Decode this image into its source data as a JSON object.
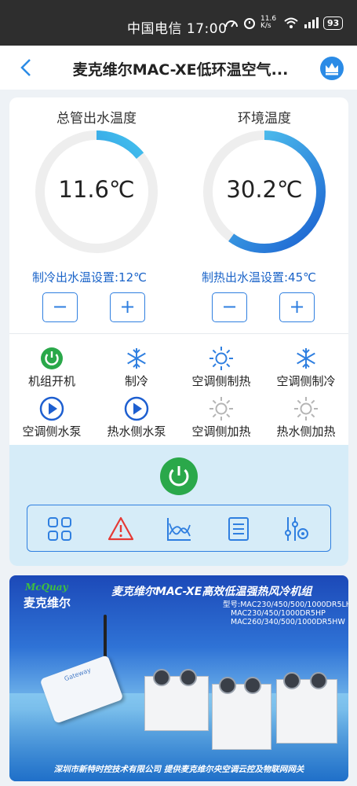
{
  "status_bar": {
    "text": "中国电信 17:00",
    "net_speed": "11.6 K/s",
    "battery": "93"
  },
  "nav": {
    "title": "麦克维尔MAC-XE低环温空气..."
  },
  "gauges": [
    {
      "title": "总管出水温度",
      "value": "11.6℃",
      "level": 0.14,
      "setpoint_label": "制冷出水温设置:12℃"
    },
    {
      "title": "环境温度",
      "value": "30.2℃",
      "level": 0.6,
      "setpoint_label": "制热出水温设置:45℃"
    }
  ],
  "buttons": {
    "minus": "−",
    "plus": "+"
  },
  "status_items": [
    {
      "label": "机组开机",
      "icon": "power-icon",
      "active": true
    },
    {
      "label": "制冷",
      "icon": "snowflake-icon",
      "active": true
    },
    {
      "label": "空调侧制热",
      "icon": "sun-icon",
      "active": true
    },
    {
      "label": "空调侧制冷",
      "icon": "snowflake-icon",
      "active": true
    },
    {
      "label": "空调侧水泵",
      "icon": "play-icon",
      "active": true
    },
    {
      "label": "热水侧水泵",
      "icon": "play-icon",
      "active": true
    },
    {
      "label": "空调侧加热",
      "icon": "sun-icon",
      "active": false
    },
    {
      "label": "热水侧加热",
      "icon": "sun-icon",
      "active": false
    }
  ],
  "colors": {
    "accent": "#2f7fe0",
    "power_green": "#2aa84a",
    "alarm_red": "#e53935",
    "inactive": "#b5b5b5"
  },
  "banner": {
    "logo": "McQuay",
    "brand": "麦克维尔",
    "title": "麦克维尔MAC-XE高效低温强热风冷机组",
    "models": [
      "型号:MAC230/450/500/1000DR5LH",
      "MAC230/450/1000DR5HP",
      "MAC260/340/500/1000DR5HW"
    ],
    "footer": "深圳市新特时控技术有限公司   提供麦克维尔央空调云控及物联网网关",
    "device_label": "Gateway"
  }
}
